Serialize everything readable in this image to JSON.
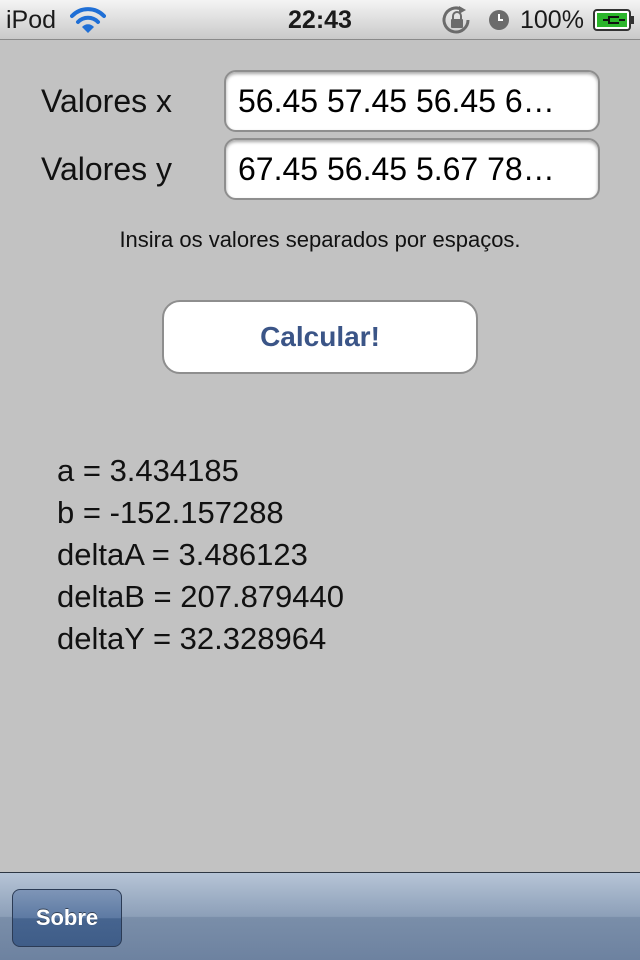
{
  "status_bar": {
    "carrier": "iPod",
    "time": "22:43",
    "battery_percent": "100%",
    "icons": [
      "wifi-icon",
      "orientation-lock-icon",
      "alarm-clock-icon",
      "battery-charging-icon"
    ]
  },
  "form": {
    "x_label": "Valores x",
    "x_value": "56.45 57.45 56.45 6…",
    "y_label": "Valores y",
    "y_value": "67.45 56.45 5.67 78…",
    "hint": "Insira os valores separados por espaços."
  },
  "calculate_button": {
    "label": "Calcular!"
  },
  "results": [
    "a = 3.434185",
    "b = -152.157288",
    "deltaA = 3.486123",
    "deltaB = 207.879440",
    "deltaY = 32.328964"
  ],
  "toolbar": {
    "about_label": "Sobre"
  },
  "colors": {
    "background": "#c2c2c2",
    "button_text": "#3b5587",
    "toolbar": "#8c9fb8",
    "battery_green": "#2bb52b"
  }
}
